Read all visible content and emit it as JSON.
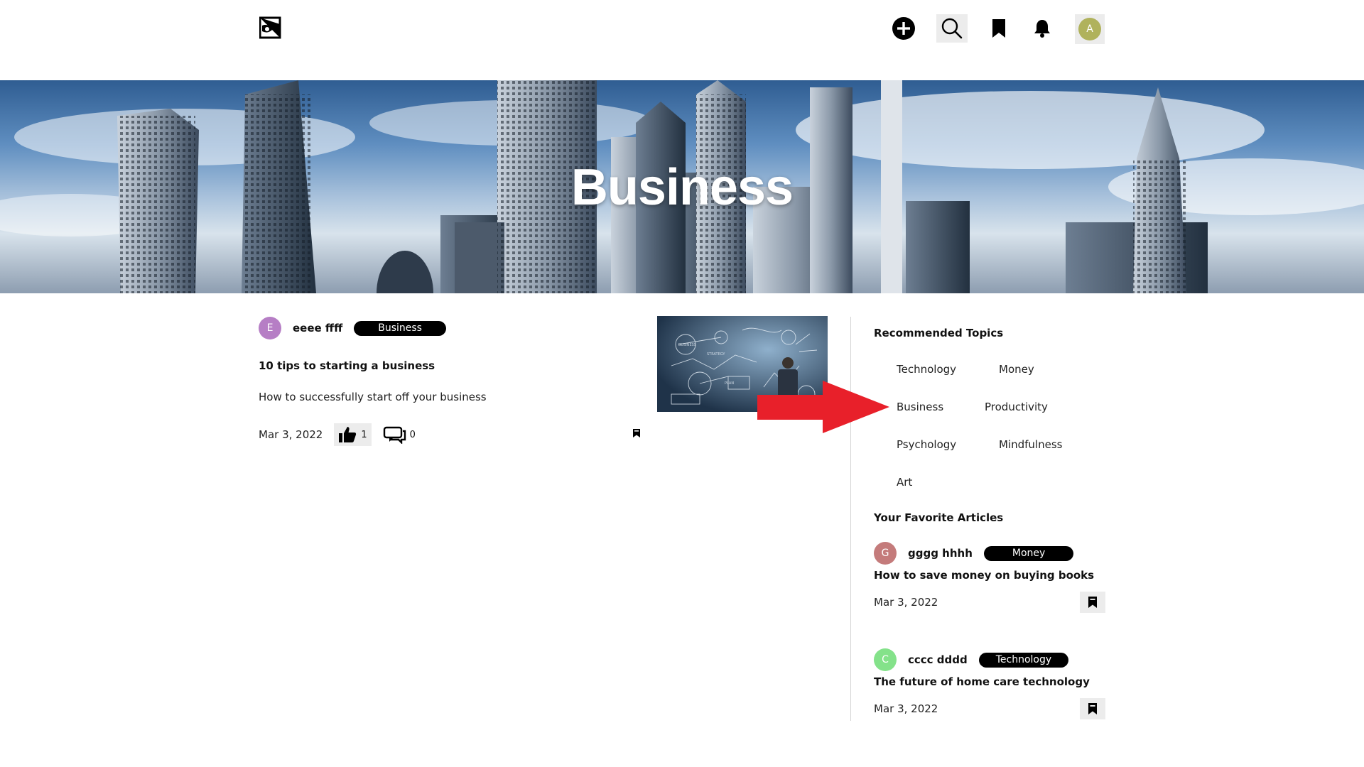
{
  "header": {
    "logo_icon": "brand-logo-icon",
    "icons": [
      "plus-circle-icon",
      "search-icon",
      "bookmark-icon",
      "bell-icon"
    ],
    "user_avatar_letter": "A",
    "user_avatar_color": "#b0b25c"
  },
  "hero": {
    "title": "Business"
  },
  "article": {
    "author_initial": "E",
    "author_color": "#b67ec5",
    "author_name": "eeee ffff",
    "tag": "Business",
    "title": "10 tips to starting a business",
    "subtitle": "How to successfully start off your business",
    "date": "Mar 3, 2022",
    "likes": "1",
    "comments": "0"
  },
  "sidebar": {
    "recommended_heading": "Recommended Topics",
    "topics": [
      "Technology",
      "Money",
      "Business",
      "Productivity",
      "Psychology",
      "Mindfulness",
      "Art"
    ],
    "favorites_heading": "Your Favorite Articles",
    "favorites": [
      {
        "author_initial": "G",
        "author_color": "#c47b7b",
        "author_name": "gggg hhhh",
        "tag": "Money",
        "title": "How to save money on buying books",
        "date": "Mar 3, 2022"
      },
      {
        "author_initial": "C",
        "author_color": "#84e28a",
        "author_name": "cccc dddd",
        "tag": "Technology",
        "title": "The future of home care technology",
        "date": "Mar 3, 2022"
      }
    ]
  },
  "annotation": {
    "arrow_color": "#e8202a"
  }
}
